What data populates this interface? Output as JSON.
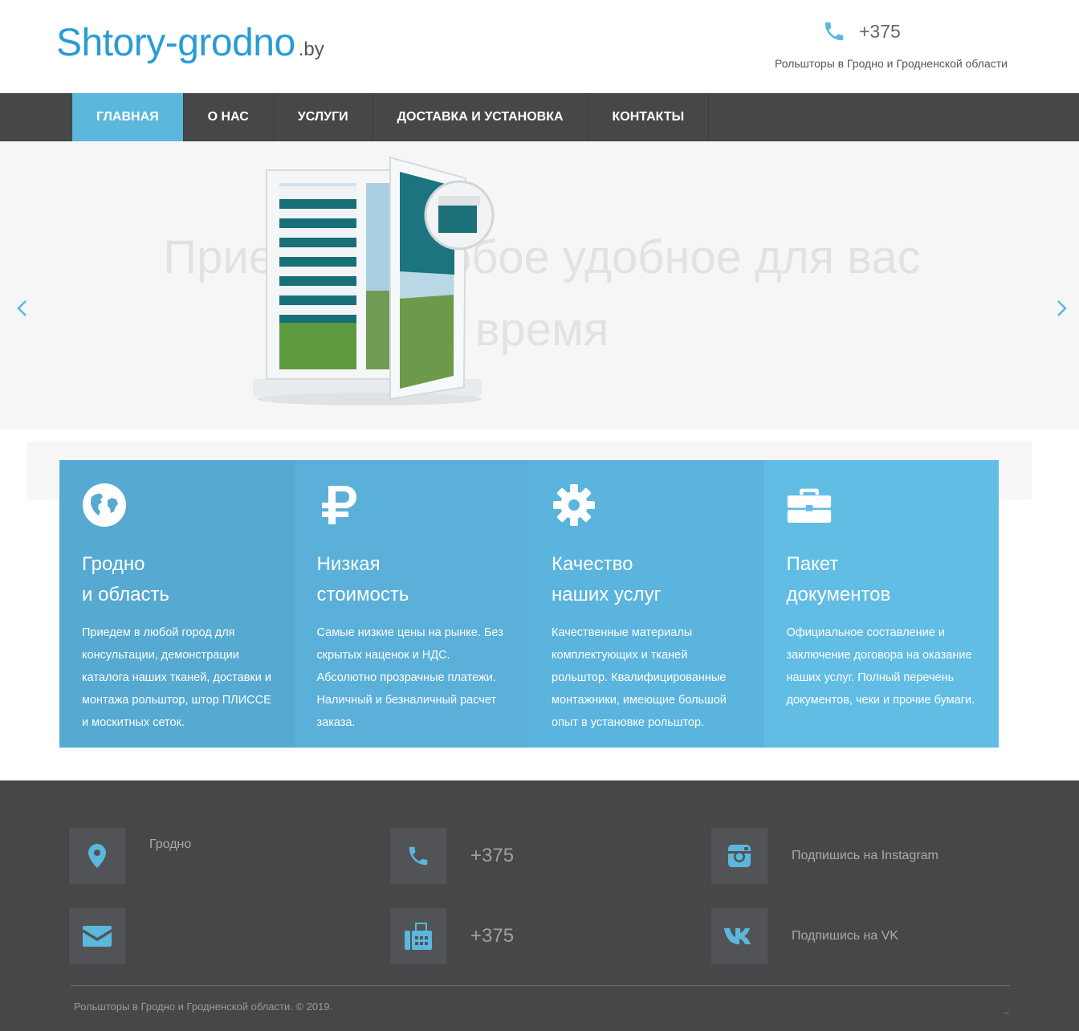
{
  "header": {
    "logo_main": "Shtory-grodno",
    "logo_tld": ".by",
    "phone": "+375",
    "tagline": "Рольшторы в Гродно и Гродненской области"
  },
  "nav": {
    "items": [
      {
        "label": "ГЛАВНАЯ"
      },
      {
        "label": "О НАС"
      },
      {
        "label": "УСЛУГИ"
      },
      {
        "label": "ДОСТАВКА И УСТАНОВКА"
      },
      {
        "label": "КОНТАКТЫ"
      }
    ],
    "active_index": 0
  },
  "hero": {
    "slide_text": "Приедем в любое удобное для вас время"
  },
  "features": [
    {
      "icon": "globe-icon",
      "title": "Гродно\nи область",
      "text": "Приедем в любой город для консультации, демонстрации каталога наших тканей, доставки и монтажа рольштор, штор ПЛИССЕ и москитных сеток."
    },
    {
      "icon": "ruble-icon",
      "title": "Низкая\nстоимость",
      "text": "Самые низкие цены на рынке. Без скрытых наценок и НДС. Абсолютно прозрачные платежи. Наличный и безналичный расчет заказа."
    },
    {
      "icon": "gear-icon",
      "title": "Качество\nнаших услуг",
      "text": "Качественные материалы комплектующих и тканей рольштор. Квалифицированные монтажники, имеющие большой опыт в установке рольштор."
    },
    {
      "icon": "briefcase-icon",
      "title": "Пакет\nдокументов",
      "text": "Официальное составление и заключение договора на оказание наших услуг. Полный перечень документов, чеки и прочие бумаги."
    }
  ],
  "footer": {
    "city": "Гродно",
    "phone1": "+375",
    "phone2": "+375",
    "instagram_label": "Подпишись на Instagram",
    "vk_label": "Подпишись на VK",
    "copyright": "Рольшторы в Гродно и Гродненской области. © 2019.",
    "dash": "_"
  },
  "colors": {
    "brand_blue": "#2a9bd6",
    "accent": "#5bb8dc",
    "nav_bg": "#464749",
    "footer_bg": "#464749"
  }
}
